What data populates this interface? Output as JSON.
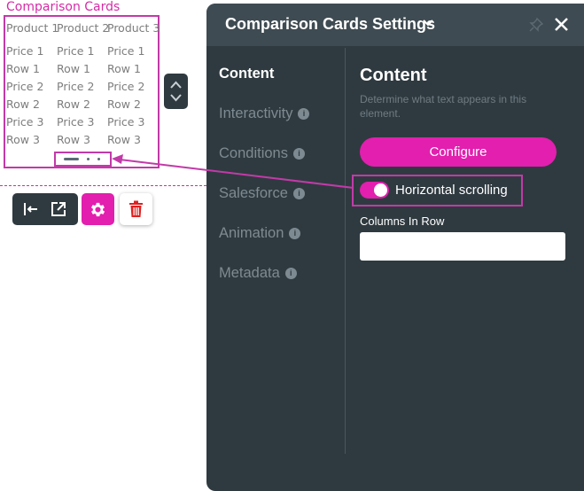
{
  "canvas": {
    "component_title": "Comparison Cards",
    "grid": {
      "headers": [
        "Product 1",
        "Product 2",
        "Product 3"
      ],
      "rows": [
        [
          "Price 1",
          "Price 1",
          "Price 1"
        ],
        [
          "Row 1",
          "Row 1",
          "Row 1"
        ],
        [
          "Price 2",
          "Price 2",
          "Price 2"
        ],
        [
          "Row 2",
          "Row 2",
          "Row 2"
        ],
        [
          "Price 3",
          "Price 3",
          "Price 3"
        ],
        [
          "Row 3",
          "Row 3",
          "Row 3"
        ]
      ]
    }
  },
  "toolbar": {
    "icons": [
      "align-left-icon",
      "external-link-icon",
      "gear-icon",
      "trash-icon"
    ]
  },
  "panel": {
    "title": "Comparison Cards Settings",
    "nav": [
      {
        "label": "Content",
        "active": true,
        "info": false
      },
      {
        "label": "Interactivity",
        "active": false,
        "info": true
      },
      {
        "label": "Conditions",
        "active": false,
        "info": true
      },
      {
        "label": "Salesforce",
        "active": false,
        "info": true
      },
      {
        "label": "Animation",
        "active": false,
        "info": true
      },
      {
        "label": "Metadata",
        "active": false,
        "info": true
      }
    ],
    "content": {
      "heading": "Content",
      "description": "Determine what text appears in this element.",
      "configure_label": "Configure",
      "horizontal_scrolling_label": "Horizontal scrolling",
      "horizontal_scrolling_on": true,
      "columns_label": "Columns In Row",
      "columns_value": ""
    }
  },
  "colors": {
    "accent": "#e21fae",
    "panel_bg": "#2f3a40",
    "panel_header": "#3f4b52",
    "highlight_border": "#c23aa8"
  }
}
